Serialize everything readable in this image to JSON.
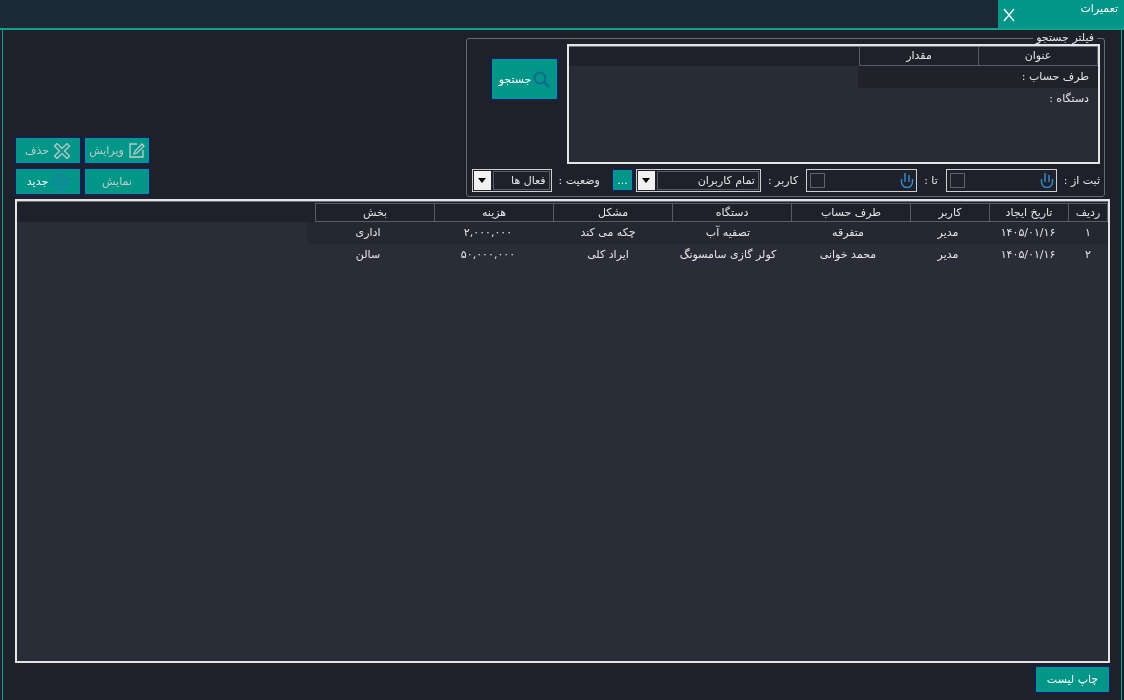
{
  "window": {
    "tab": {
      "title": "تعمیرات",
      "selected": true
    }
  },
  "filter": {
    "title": "فیلتر جستجو",
    "grid": {
      "columns": [
        "عنوان",
        "مقدار"
      ],
      "rows": [
        {
          "title": "طرف حساب :"
        },
        {
          "title": "دستگاه :"
        }
      ]
    },
    "search_button": "جستجو",
    "fields": [
      {
        "kind": "date",
        "label": "ثبت از :",
        "checked": false
      },
      {
        "kind": "date",
        "label": "تا :",
        "checked": false
      },
      {
        "kind": "combo",
        "label": "کاربر :",
        "value": "تمام کاربران"
      },
      {
        "kind": "button",
        "text": "..."
      },
      {
        "kind": "combo",
        "label": "وضعیت :",
        "value": "فعال ها"
      }
    ]
  },
  "actions": [
    {
      "kind": "edit",
      "label": "ویرایش",
      "disabled": true
    },
    {
      "kind": "delete",
      "label": "حذف",
      "disabled": true
    },
    {
      "kind": "view",
      "label": "نمایش",
      "disabled": true
    },
    {
      "kind": "new",
      "label": "جدید",
      "disabled": false
    }
  ],
  "table": {
    "columns": [
      "ردیف",
      "تاریخ ایجاد",
      "کاربر",
      "طرف حساب",
      "دستگاه",
      "مشکل",
      "هزینه",
      "بخش"
    ],
    "rows": [
      [
        "۱",
        "۱۴۰۵/۰۱/۱۶",
        "مدیر",
        "متفرقه",
        "تصفیه آب",
        "چکه می کند",
        "۲,۰۰۰,۰۰۰",
        "اداری"
      ],
      [
        "۲",
        "۱۴۰۵/۰۱/۱۶",
        "مدیر",
        "محمد خوانی",
        "کولر گازی سامسونگ",
        "ایراد کلی",
        "۵۰,۰۰۰,۰۰۰",
        "سالن"
      ]
    ]
  },
  "print_button": "چاپ لیست"
}
